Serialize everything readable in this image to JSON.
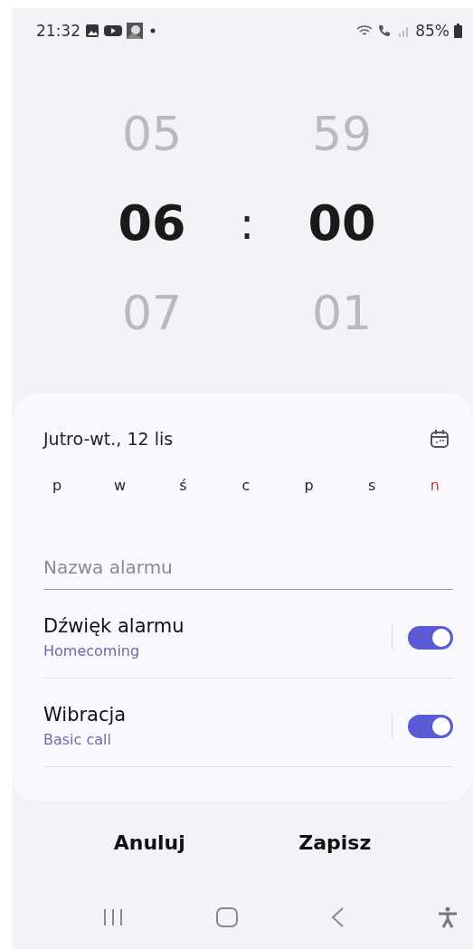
{
  "status_bar": {
    "time": "21:32",
    "battery": "85%"
  },
  "time_picker": {
    "hours": {
      "previous": "05",
      "selected": "06",
      "next": "07"
    },
    "separator": ":",
    "minutes": {
      "previous": "59",
      "selected": "00",
      "next": "01"
    }
  },
  "date": {
    "label": "Jutro-wt., 12 lis"
  },
  "days": [
    {
      "label": "p",
      "color": "#222222"
    },
    {
      "label": "w",
      "color": "#222222"
    },
    {
      "label": "ś",
      "color": "#222222"
    },
    {
      "label": "c",
      "color": "#222222"
    },
    {
      "label": "p",
      "color": "#222222"
    },
    {
      "label": "s",
      "color": "#222222"
    },
    {
      "label": "n",
      "color": "#b5423f"
    }
  ],
  "alarm_name": {
    "placeholder": "Nazwa alarmu"
  },
  "settings": [
    {
      "title": "Dźwięk alarmu",
      "subtitle": "Homecoming",
      "on": true
    },
    {
      "title": "Wibracja",
      "subtitle": "Basic call",
      "on": true
    }
  ],
  "buttons": [
    "Anuluj",
    "Zapisz"
  ]
}
